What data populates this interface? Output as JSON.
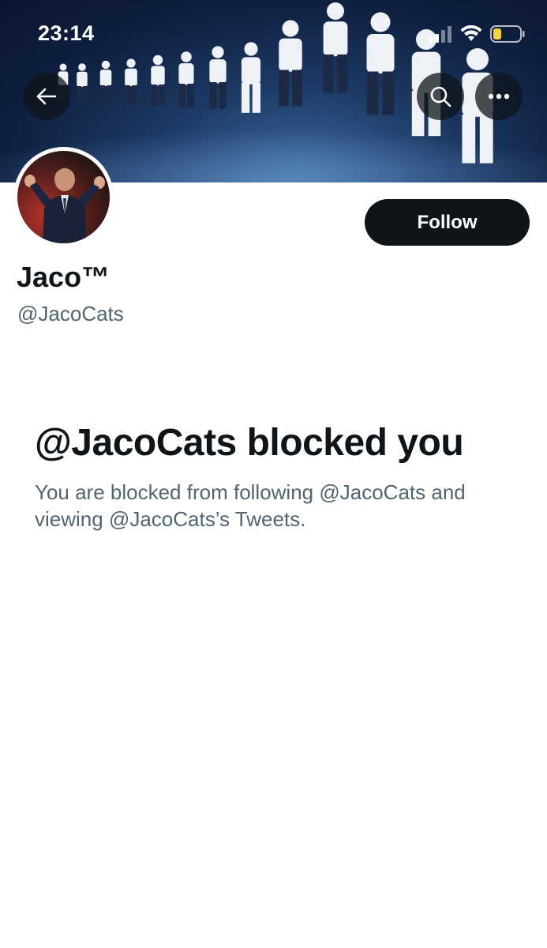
{
  "status_bar": {
    "time": "23:14"
  },
  "navigation": {
    "back_icon": "arrow-left-icon",
    "search_icon": "search-icon",
    "more_icon": "more-horizontal-icon"
  },
  "profile": {
    "display_name": "Jaco™",
    "handle": "@JacoCats",
    "follow_label": "Follow"
  },
  "blocked": {
    "title": "@JacoCats blocked you",
    "description": "You are blocked from following @JacoCats and viewing @JacoCats’s Tweets."
  },
  "colors": {
    "primary_text": "#0f1419",
    "secondary_text": "#536471",
    "follow_button_bg": "#0f1419",
    "banner_bg": "#0f1f3f",
    "battery_level": "#f5d142"
  }
}
